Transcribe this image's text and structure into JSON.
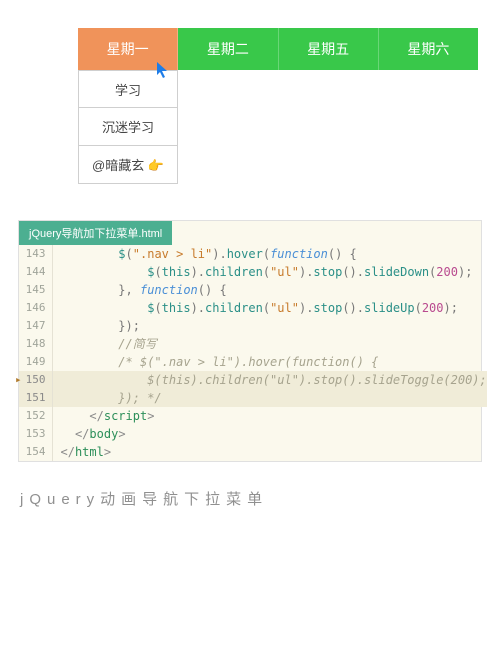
{
  "nav": {
    "items": [
      {
        "label": "星期一",
        "active": true
      },
      {
        "label": "星期二",
        "active": false
      },
      {
        "label": "星期五",
        "active": false
      },
      {
        "label": "星期六",
        "active": false
      }
    ],
    "dropdown": [
      "学习",
      "沉迷学习",
      "@暗藏玄 👉"
    ]
  },
  "editor": {
    "tab": "jQuery导航加下拉菜单.html",
    "lines": {
      "l143_sel": "\".nav > li\"",
      "l143_kw": "function",
      "l144_sel": "\"ul\"",
      "l144_num": "200",
      "l145_kw": "function",
      "l146_sel": "\"ul\"",
      "l146_num": "200",
      "l148_cm": "//简写",
      "l149_cm": "/* $(\".nav > li\").hover(function() {",
      "l150_cm": "$(this).children(\"ul\").stop().slideToggle(200);",
      "l151_cm": "}); */"
    },
    "start": 143,
    "end": 154
  },
  "caption": "jQuery动画导航下拉菜单"
}
